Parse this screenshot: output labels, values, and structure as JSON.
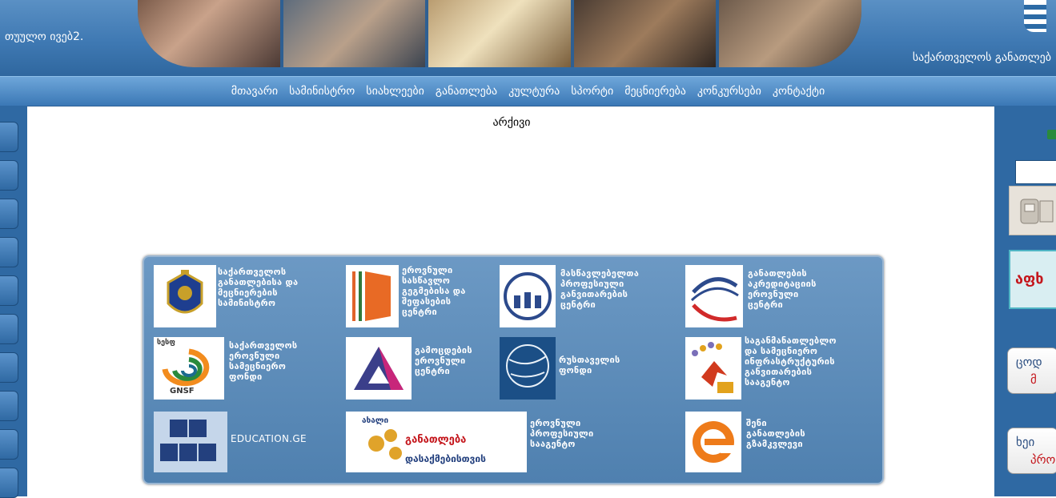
{
  "header": {
    "left_text": "თუულო ივებ2.",
    "right_text": "საქართველოს განათლებ"
  },
  "nav": {
    "items": [
      "მთავარი",
      "სამინისტრო",
      "სიახლეები",
      "განათლება",
      "კულტურა",
      "სპორტი",
      "მეცნიერება",
      "კონკურსები",
      "კონტაქტი"
    ]
  },
  "main": {
    "title": "არქივი"
  },
  "partners": [
    {
      "label": "საქართველოს\nგანათლებისა და\nმეცნიერების\nსამინისტრო",
      "icon": "ministry-emblem-icon"
    },
    {
      "label": "ეროვნული\nსასწავლო\nგეგმებისა და\nშეფასების\nცენტრი",
      "icon": "national-curriculum-logo-icon"
    },
    {
      "label": "მასწავლებელთა\nპროფესიული\nგანვითარების\nცენტრი",
      "icon": "teacher-development-logo-icon"
    },
    {
      "label": "განათლების\nაკრედიტაციის\nეროვნული\nცენტრი",
      "icon": "accreditation-logo-icon"
    },
    {
      "label": "საქართველოს\nეროვნული\nსამეცნიერო\nფონდი",
      "icon": "gnsf-logo-icon",
      "logo_top_text": "სესფ",
      "logo_bottom_text": "GNSF"
    },
    {
      "label": "გამოცდების\nეროვნული\nცენტრი",
      "icon": "exams-center-logo-icon"
    },
    {
      "label": "რუსთაველის\nფონდი",
      "icon": "rustaveli-fund-logo-icon"
    },
    {
      "label": "საგანმანათლებლო\nდა სამეცნიერო\nინფრასტრუქტურის\nგანვითარების\nსააგენტო",
      "icon": "infrastructure-agency-logo-icon"
    },
    {
      "label": "EDUCATION.GE",
      "icon": "education-ge-cubes-icon"
    },
    {
      "label": "ეროვნული\nპროფესიული\nსააგენტო",
      "icon": "professional-education-logo-icon",
      "logo_top_text": "ახალი",
      "logo_mid_text": "განათლება",
      "logo_bottom_text": "დასაქმებისთვის"
    },
    {
      "label": "შენი\nგანათლების\nგზამკვლევი",
      "icon": "e-guide-logo-icon"
    }
  ],
  "right_sidebar": {
    "banner_text": "აფხ",
    "button1": {
      "line1": "ცოდ",
      "line2": "მ"
    },
    "button2": {
      "line1": "ხეი",
      "line2": "პროფ"
    }
  },
  "colors": {
    "header_blue": "#3f79b3",
    "nav_blue": "#4d87c2",
    "panel_blue": "#5a88b7",
    "accent_red": "#c4161c"
  }
}
